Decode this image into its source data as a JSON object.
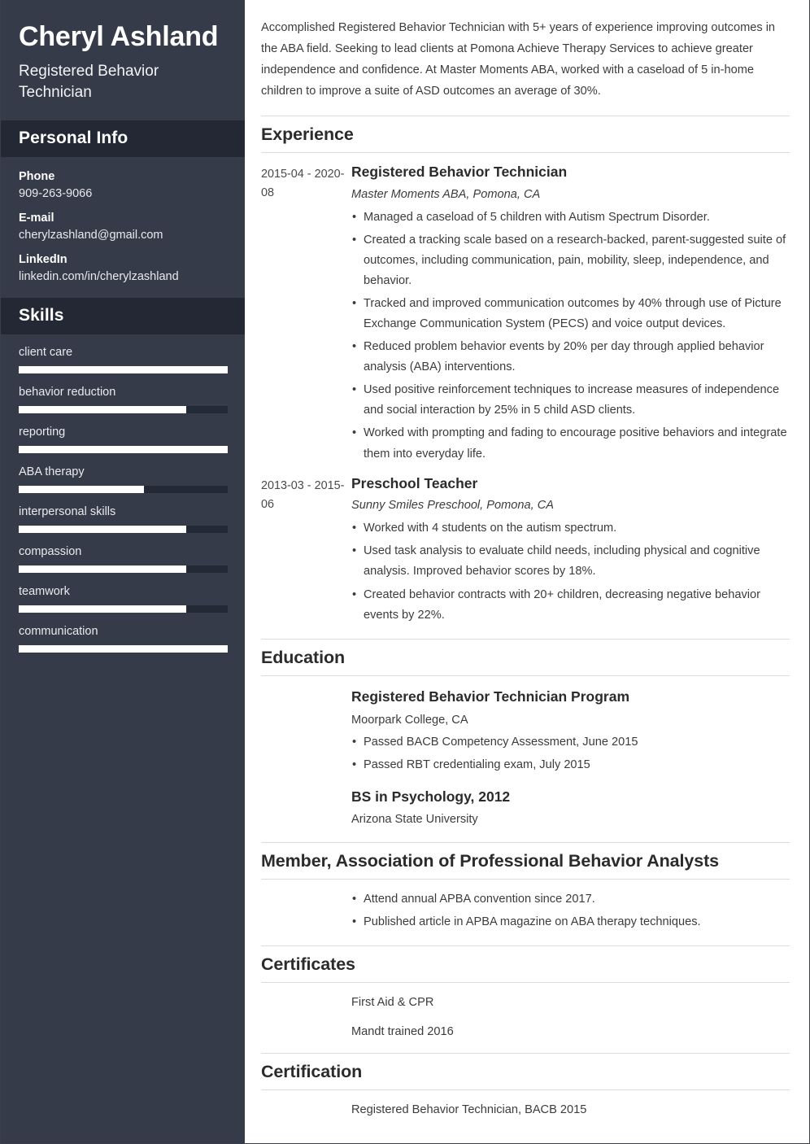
{
  "sidebar": {
    "name": "Cheryl Ashland",
    "job_title": "Registered Behavior Technician",
    "personal_info_heading": "Personal Info",
    "contacts": [
      {
        "label": "Phone",
        "value": "909-263-9066"
      },
      {
        "label": "E-mail",
        "value": "cherylzashland@gmail.com"
      },
      {
        "label": "LinkedIn",
        "value": "linkedin.com/in/cherylzashland"
      }
    ],
    "skills_heading": "Skills",
    "skills": [
      {
        "name": "client care",
        "level": 100
      },
      {
        "name": "behavior reduction",
        "level": 80
      },
      {
        "name": "reporting",
        "level": 100
      },
      {
        "name": "ABA therapy",
        "level": 60
      },
      {
        "name": "interpersonal skills",
        "level": 80
      },
      {
        "name": "compassion",
        "level": 80
      },
      {
        "name": "teamwork",
        "level": 80
      },
      {
        "name": "communication",
        "level": 100
      }
    ],
    "colors": {
      "background": "#353b48",
      "band": "#232834",
      "bar_track": "#242936",
      "bar_fill": "#ffffff"
    }
  },
  "main": {
    "summary": "Accomplished Registered Behavior Technician with 5+ years of experience improving outcomes in the ABA field. Seeking to lead clients at Pomona Achieve Therapy Services to achieve greater independence and confidence. At Master Moments ABA, worked with a caseload of 5 in-home children to improve a suite of ASD outcomes an average of 30%.",
    "experience": {
      "heading": "Experience",
      "entries": [
        {
          "dates": "2015-04 - 2020-08",
          "role": "Registered Behavior Technician",
          "org": "Master Moments ABA, Pomona, CA",
          "bullets": [
            "Managed a caseload of 5 children with Autism Spectrum Disorder.",
            "Created a tracking scale based on a research-backed, parent-suggested suite of outcomes, including communication, pain, mobility, sleep, independence, and behavior.",
            "Tracked and improved communication outcomes by 40% through use of Picture Exchange Communication System (PECS) and voice output devices.",
            "Reduced problem behavior events by 20% per day through applied behavior analysis (ABA) interventions.",
            "Used positive reinforcement techniques to increase measures of independence and social interaction by 25% in 5 child ASD clients.",
            "Worked with prompting and fading to encourage positive behaviors and integrate them into everyday life."
          ]
        },
        {
          "dates": "2013-03 - 2015-06",
          "role": "Preschool Teacher",
          "org": "Sunny Smiles Preschool, Pomona, CA",
          "bullets": [
            "Worked with 4 students on the autism spectrum.",
            "Used task analysis to evaluate child needs, including physical and cognitive analysis. Improved behavior scores by 18%.",
            "Created behavior contracts with 20+ children, decreasing negative behavior events by 22%."
          ]
        }
      ]
    },
    "education": {
      "heading": "Education",
      "entries": [
        {
          "degree": "Registered Behavior Technician Program",
          "school": "Moorpark College, CA",
          "bullets": [
            "Passed BACB Competency Assessment, June 2015",
            "Passed RBT credentialing exam, July 2015"
          ]
        },
        {
          "degree": "BS in Psychology, 2012",
          "school": "Arizona State University",
          "bullets": []
        }
      ]
    },
    "membership": {
      "heading": "Member, Association of Professional Behavior Analysts",
      "bullets": [
        "Attend annual APBA convention since 2017.",
        "Published article in APBA magazine on ABA therapy techniques."
      ]
    },
    "certificates": {
      "heading": "Certificates",
      "items": [
        "First Aid & CPR",
        "Mandt trained 2016"
      ]
    },
    "certification": {
      "heading": "Certification",
      "items": [
        "Registered Behavior Technician, BACB 2015"
      ]
    }
  }
}
